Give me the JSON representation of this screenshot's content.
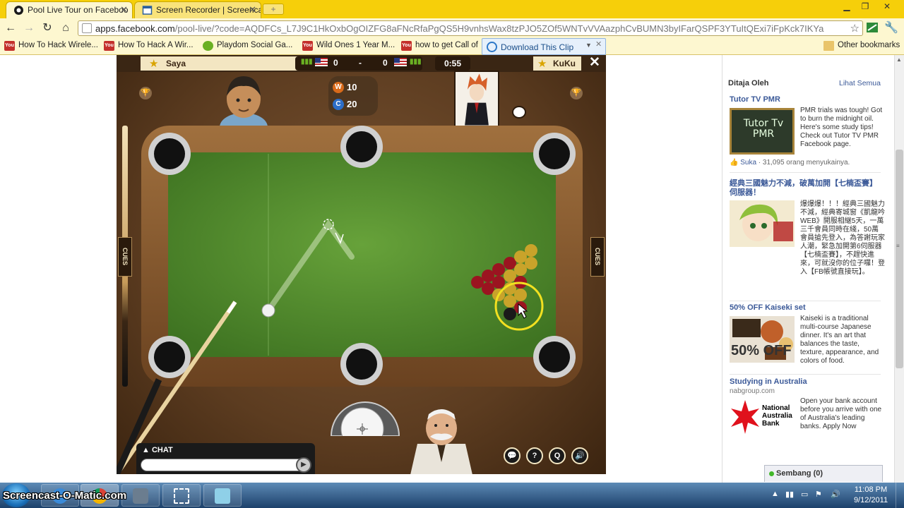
{
  "browser": {
    "tabs": [
      {
        "title": "Pool Live Tour on Faceboo",
        "active": true
      },
      {
        "title": "Screen Recorder | Screencas",
        "active": false
      }
    ],
    "url_host": "apps.facebook.com",
    "url_path": "/pool-live/?code=AQDFCs_L7J9C1HkOxbOgOIZFG8aFNcRfaPgQS5H9vnhsWax8tzPJO5ZOf5WNTvVVAazphCvBUMN3byIFarQSPF3YTuItQExi7iFpKck7IKYa",
    "bookmarks": [
      "How To Hack Wirele...",
      "How To Hack A Wir...",
      "Playdom Social Ga...",
      "Wild Ones 1 Year M...",
      "how to get Call of"
    ],
    "other_bookmarks": "Other bookmarks",
    "download_clip": "Download This Clip",
    "accent": "#f6cf0a"
  },
  "game": {
    "player_left": "Saya",
    "player_right": "KuKu",
    "score_left": "0",
    "score_sep": "-",
    "score_right": "0",
    "timer": "0:55",
    "wins": "10",
    "coins": "20",
    "cues_label": "CUES",
    "chat_label": "CHAT",
    "chat_input": "",
    "felt_color": "#4f8a2b",
    "rail_color": "#8a5a2e"
  },
  "sidebar": {
    "heading": "Ditaja Oleh",
    "see_all": "Lihat Semua",
    "ads": [
      {
        "title": "Tutor TV PMR",
        "image_text": "Tutor Tv PMR",
        "body": "PMR trials was tough! Got to burn the midnight oil. Here's some study tips! Check out Tutor TV PMR Facebook page.",
        "like_label": "Suka",
        "like_count": "31,095 orang menyukainya."
      },
      {
        "title": "經典三國魅力不減，破萬加開【七楠盃賽】伺服器！",
        "body": "爆爆爆！！！經典三國魅力不減，經典寄城窗《凱龍吟WEB》開服相継5天，一萬三千會員同時在綫，50萬會員搶先登入，為答謝玩家人潮，緊急加開第6伺服器【七楠盃賽】，不趕快進來，可就沒你的位子囉！登入【FB帳號直接玩】。"
      },
      {
        "title": "50% OFF Kaiseki set",
        "image_text": "50% OFF",
        "body": "Kaiseki is a traditional multi-course Japanese dinner. It's an art that balances the taste, texture, appearance, and colors of food."
      },
      {
        "title": "Studying in Australia",
        "subtitle": "nabgroup.com",
        "image_text": "National Australia Bank",
        "body": "Open your bank account before you arrive with one of Australia's leading banks. Apply Now"
      }
    ],
    "chat_bar": "Sembang (0)",
    "link_color": "#3b5998"
  },
  "taskbar": {
    "watermark": "Screencast-O-Matic.com",
    "time": "11:08 PM",
    "date": "9/12/2011"
  }
}
